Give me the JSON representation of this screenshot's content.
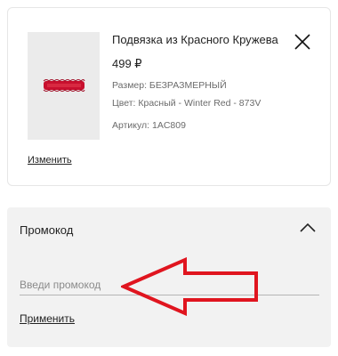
{
  "product": {
    "title": "Подвязка из Красного Кружева",
    "price": "499 ₽",
    "size": "Размер: БЕЗРАЗМЕРНЫЙ",
    "color": "Цвет: Красный - Winter Red - 873V",
    "sku": "Артикул: 1AC809",
    "change_label": "Изменить",
    "image_icon": "red-lace-garter"
  },
  "promo": {
    "title": "Промокод",
    "placeholder": "Введи промокод",
    "value": "",
    "apply_label": "Применить"
  },
  "annotation": {
    "arrow_color": "#e0151f",
    "direction": "left"
  }
}
